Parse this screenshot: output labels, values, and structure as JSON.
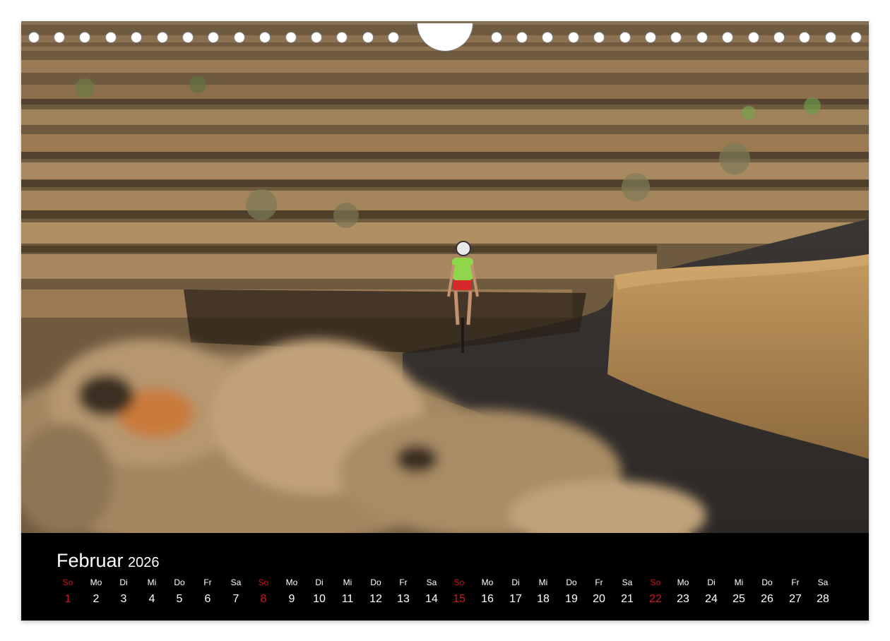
{
  "photo": {
    "subject": "cyclist-on-road-between-stone-walls"
  },
  "calendar": {
    "month": "Februar",
    "year": "2026",
    "sunday_color": "#d2141d",
    "days": [
      {
        "name": "So",
        "num": "1",
        "sunday": true
      },
      {
        "name": "Mo",
        "num": "2"
      },
      {
        "name": "Di",
        "num": "3"
      },
      {
        "name": "Mi",
        "num": "4"
      },
      {
        "name": "Do",
        "num": "5"
      },
      {
        "name": "Fr",
        "num": "6"
      },
      {
        "name": "Sa",
        "num": "7"
      },
      {
        "name": "So",
        "num": "8",
        "sunday": true
      },
      {
        "name": "Mo",
        "num": "9"
      },
      {
        "name": "Di",
        "num": "10"
      },
      {
        "name": "Mi",
        "num": "11"
      },
      {
        "name": "Do",
        "num": "12"
      },
      {
        "name": "Fr",
        "num": "13"
      },
      {
        "name": "Sa",
        "num": "14"
      },
      {
        "name": "So",
        "num": "15",
        "sunday": true
      },
      {
        "name": "Mo",
        "num": "16"
      },
      {
        "name": "Di",
        "num": "17"
      },
      {
        "name": "Mi",
        "num": "18"
      },
      {
        "name": "Do",
        "num": "19"
      },
      {
        "name": "Fr",
        "num": "20"
      },
      {
        "name": "Sa",
        "num": "21"
      },
      {
        "name": "So",
        "num": "22",
        "sunday": true
      },
      {
        "name": "Mo",
        "num": "23"
      },
      {
        "name": "Di",
        "num": "24"
      },
      {
        "name": "Mi",
        "num": "25"
      },
      {
        "name": "Do",
        "num": "26"
      },
      {
        "name": "Fr",
        "num": "27"
      },
      {
        "name": "Sa",
        "num": "28"
      }
    ]
  }
}
